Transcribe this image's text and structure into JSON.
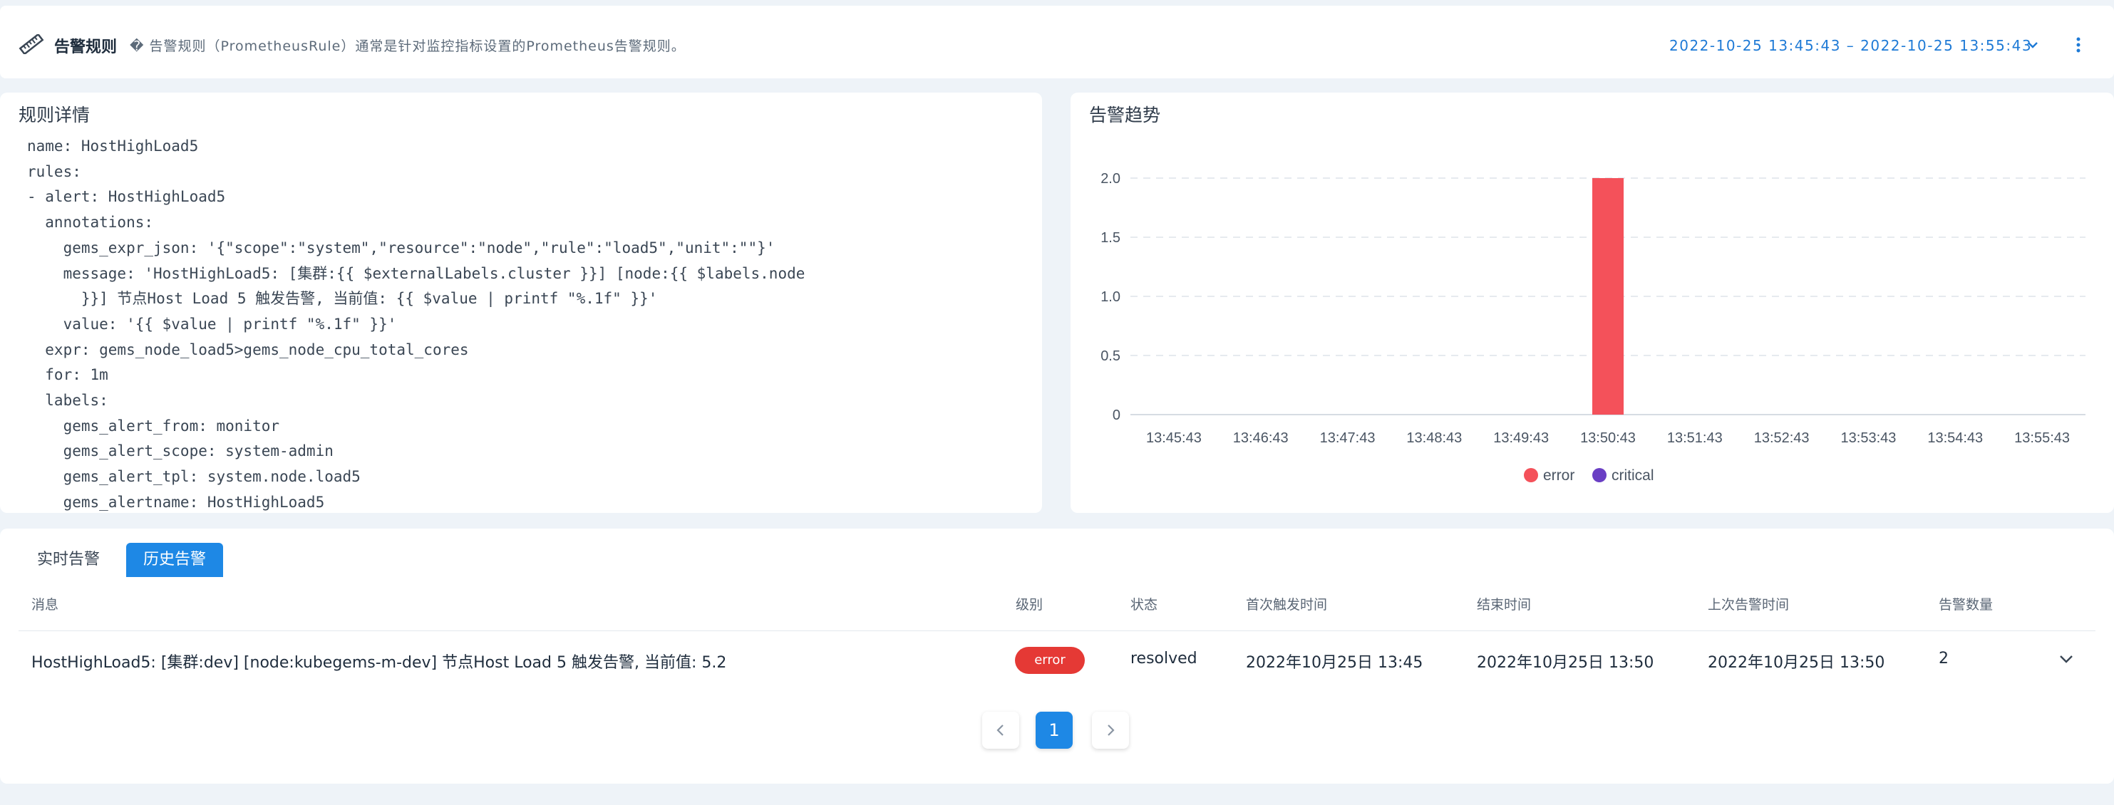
{
  "header": {
    "title": "告警规则",
    "description": "� 告警规则（PrometheusRule）通常是针对监控指标设置的Prometheus告警规则。",
    "time_range": "2022-10-25 13:45:43 – 2022-10-25 13:55:43",
    "icons": [
      "ruler-icon",
      "chevron-down-icon",
      "more-vertical-icon"
    ]
  },
  "rule_detail": {
    "title": "规则详情",
    "yaml_lines": [
      "name: HostHighLoad5",
      "rules:",
      "- alert: HostHighLoad5",
      "  annotations:",
      "    gems_expr_json: '{\"scope\":\"system\",\"resource\":\"node\",\"rule\":\"load5\",\"unit\":\"\"}'",
      "    message: 'HostHighLoad5: [集群:{{ $externalLabels.cluster }}] [node:{{ $labels.node",
      "      }}] 节点Host Load 5 触发告警, 当前值: {{ $value | printf \"%.1f\" }}'",
      "    value: '{{ $value | printf \"%.1f\" }}'",
      "  expr: gems_node_load5>gems_node_cpu_total_cores",
      "  for: 1m",
      "  labels:",
      "    gems_alert_from: monitor",
      "    gems_alert_scope: system-admin",
      "    gems_alert_tpl: system.node.load5",
      "    gems_alertname: HostHighLoad5"
    ]
  },
  "trend": {
    "title": "告警趋势"
  },
  "chart_data": {
    "type": "bar",
    "title": "告警趋势",
    "categories": [
      "13:45:43",
      "13:46:43",
      "13:47:43",
      "13:48:43",
      "13:49:43",
      "13:50:43",
      "13:51:43",
      "13:52:43",
      "13:53:43",
      "13:54:43",
      "13:55:43"
    ],
    "series": [
      {
        "name": "error",
        "color": "#f4515a",
        "values": [
          0,
          0,
          0,
          0,
          0,
          2,
          0,
          0,
          0,
          0,
          0
        ]
      },
      {
        "name": "critical",
        "color": "#6a3fc4",
        "values": [
          0,
          0,
          0,
          0,
          0,
          0,
          0,
          0,
          0,
          0,
          0
        ]
      }
    ],
    "yticks": [
      "0",
      "0.5",
      "1.0",
      "1.5",
      "2.0"
    ],
    "ylim": [
      0,
      2
    ],
    "grid": true,
    "legend": "bottom-center"
  },
  "tabs": [
    {
      "label": "实时告警",
      "active": false
    },
    {
      "label": "历史告警",
      "active": true
    }
  ],
  "table": {
    "headers": [
      "消息",
      "级别",
      "状态",
      "首次触发时间",
      "结束时间",
      "上次告警时间",
      "告警数量"
    ],
    "rows": [
      {
        "message": "HostHighLoad5: [集群:dev] [node:kubegems-m-dev] 节点Host Load 5 触发告警, 当前值: 5.2",
        "level": "error",
        "status": "resolved",
        "first_triggered": "2022年10月25日 13:45",
        "ended": "2022年10月25日 13:50",
        "last_alert": "2022年10月25日 13:50",
        "count": "2"
      }
    ]
  },
  "pagination": {
    "current_page": "1"
  },
  "colors": {
    "accent": "#1e88e5",
    "error": "#e53935",
    "page_bg": "#eef3f8"
  }
}
